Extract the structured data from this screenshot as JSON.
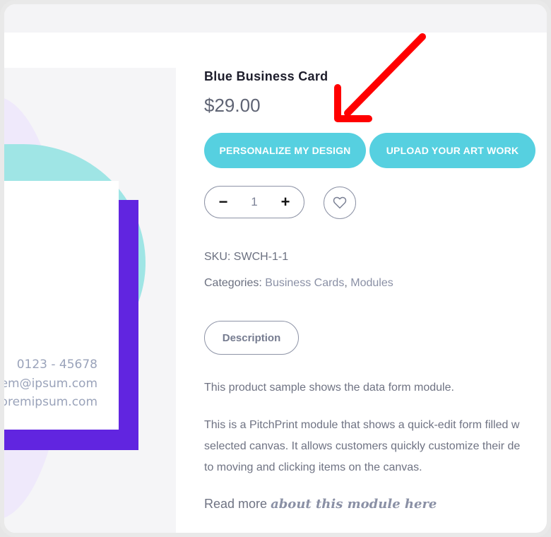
{
  "product": {
    "title": "Blue Business Card",
    "price": "$29.00"
  },
  "buttons": {
    "personalize": "PERSONALIZE MY DESIGN",
    "upload": "UPLOAD YOUR ART WORK"
  },
  "quantity": {
    "minus": "−",
    "value": "1",
    "plus": "+"
  },
  "meta": {
    "sku_label": "SKU:",
    "sku_value": "SWCH-1-1",
    "categories_label": "Categories:",
    "category_1": "Business Cards",
    "separator": ",",
    "category_2": "Modules"
  },
  "tabs": {
    "description": "Description"
  },
  "description": {
    "line1": "This product sample shows the data form module.",
    "line2": "This is a PitchPrint module that shows a quick-edit form filled w",
    "line3": "selected canvas. It allows customers quickly customize their de",
    "line4": "to moving and clicking items on the canvas.",
    "readmore_prefix": "Read more",
    "readmore_link": "about this module here"
  },
  "card_preview": {
    "phone": "0123 - 45678",
    "email": "em@ipsum.com",
    "web": "oremipsum.com"
  },
  "colors": {
    "accent": "#56d0e0",
    "annotation_arrow": "#ff0000",
    "card_purple": "#6125e0",
    "card_teal": "#9fe5e5"
  },
  "icons": {
    "wishlist": "heart-outline-icon",
    "annotation": "red-arrow-icon"
  }
}
